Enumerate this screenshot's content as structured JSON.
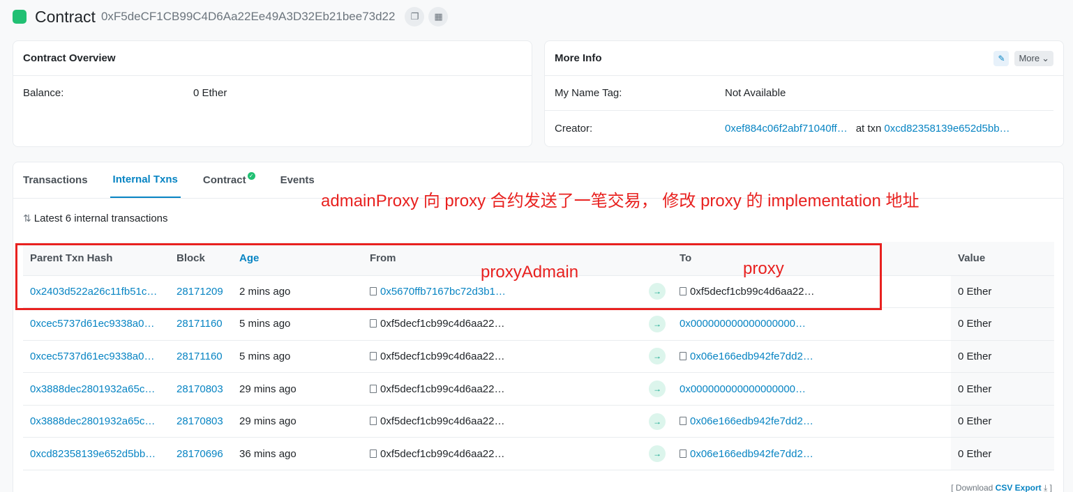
{
  "header": {
    "title": "Contract",
    "address": "0xF5deCF1CB99C4D6Aa22Ee49A3D32Eb21bee73d22"
  },
  "overview": {
    "title": "Contract Overview",
    "balance_label": "Balance:",
    "balance_value": "0 Ether"
  },
  "more_info": {
    "title": "More Info",
    "more_label": "More",
    "name_tag_label": "My Name Tag:",
    "name_tag_value": "Not Available",
    "creator_label": "Creator:",
    "creator_address": "0xef884c06f2abf71040ff…",
    "at_txn_label": "at txn",
    "creator_txn": "0xcd82358139e652d5bb…"
  },
  "tabs": [
    {
      "label": "Transactions"
    },
    {
      "label": "Internal Txns"
    },
    {
      "label": "Contract"
    },
    {
      "label": "Events"
    }
  ],
  "latest_label": "Latest 6 internal transactions",
  "table": {
    "headers": {
      "parent": "Parent Txn Hash",
      "block": "Block",
      "age": "Age",
      "from": "From",
      "to": "To",
      "value": "Value"
    },
    "rows": [
      {
        "parent": "0x2403d522a26c11fb51c…",
        "block": "28171209",
        "age": "2 mins ago",
        "from": "0x5670ffb7167bc72d3b1…",
        "to": "0xf5decf1cb99c4d6aa22…",
        "value": "0 Ether"
      },
      {
        "parent": "0xcec5737d61ec9338a0…",
        "block": "28171160",
        "age": "5 mins ago",
        "from": "0xf5decf1cb99c4d6aa22…",
        "to": "0x000000000000000000…",
        "value": "0 Ether"
      },
      {
        "parent": "0xcec5737d61ec9338a0…",
        "block": "28171160",
        "age": "5 mins ago",
        "from": "0xf5decf1cb99c4d6aa22…",
        "to": "0x06e166edb942fe7dd2…",
        "value": "0 Ether"
      },
      {
        "parent": "0x3888dec2801932a65c…",
        "block": "28170803",
        "age": "29 mins ago",
        "from": "0xf5decf1cb99c4d6aa22…",
        "to": "0x000000000000000000…",
        "value": "0 Ether"
      },
      {
        "parent": "0x3888dec2801932a65c…",
        "block": "28170803",
        "age": "29 mins ago",
        "from": "0xf5decf1cb99c4d6aa22…",
        "to": "0x06e166edb942fe7dd2…",
        "value": "0 Ether"
      },
      {
        "parent": "0xcd82358139e652d5bb…",
        "block": "28170696",
        "age": "36 mins ago",
        "from": "0xf5decf1cb99c4d6aa22…",
        "to": "0x06e166edb942fe7dd2…",
        "value": "0 Ether"
      }
    ]
  },
  "footer": {
    "prefix": "[ Download",
    "csv": "CSV Export",
    "suffix": "⤓ ]"
  },
  "annotations": {
    "main": "admainProxy 向 proxy 合约发送了一笔交易， 修改 proxy 的 implementation 地址",
    "from_label": "proxyAdmain",
    "to_label": "proxy"
  },
  "colors": {
    "link": "#0784c3",
    "annotation": "#e8211f",
    "brand": "#21c073"
  }
}
